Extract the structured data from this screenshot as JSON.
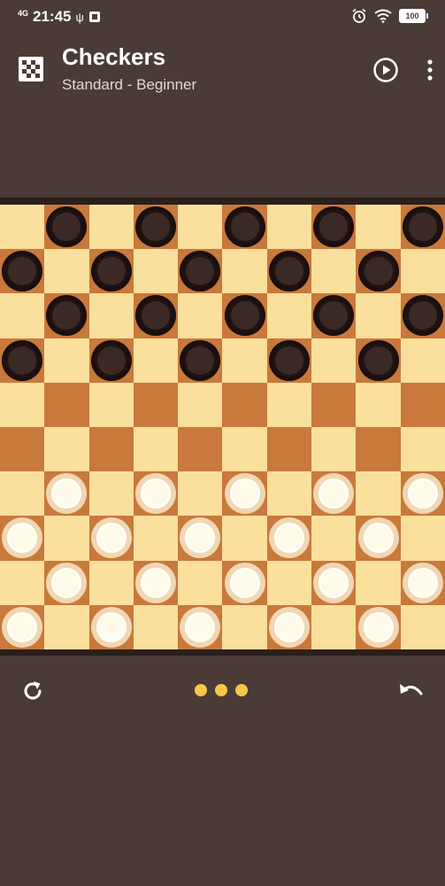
{
  "status_bar": {
    "network": "4G",
    "time": "21:45",
    "usb_glyph": "ψ",
    "battery": "100",
    "icons": [
      "usb-icon",
      "notification-icon",
      "alarm-icon",
      "wifi-icon",
      "battery-icon"
    ]
  },
  "app_bar": {
    "title": "Checkers",
    "subtitle": "Standard - Beginner",
    "icons": [
      "board-icon",
      "play-icon",
      "more-vert-icon"
    ]
  },
  "board": {
    "size": 10,
    "colors": {
      "light": "#fbdf9c",
      "dark": "#c8793b",
      "frame": "#2b1f1c"
    },
    "rows": [
      "_b_b_b_b_b",
      "b_b_b_b_b_",
      "_b_b_b_b_b",
      "b_b_b_b_b_",
      "__________",
      "__________",
      "_w_w_w_w_w",
      "w_w_w_w_w_",
      "_w_w_w_w_w",
      "w_w_w_w_w_"
    ]
  },
  "bottom_bar": {
    "icons": [
      "restart-icon",
      "undo-icon"
    ],
    "dot_count": 3,
    "dot_color": "#f7c748"
  },
  "colors": {
    "background": "#4a3b37"
  }
}
